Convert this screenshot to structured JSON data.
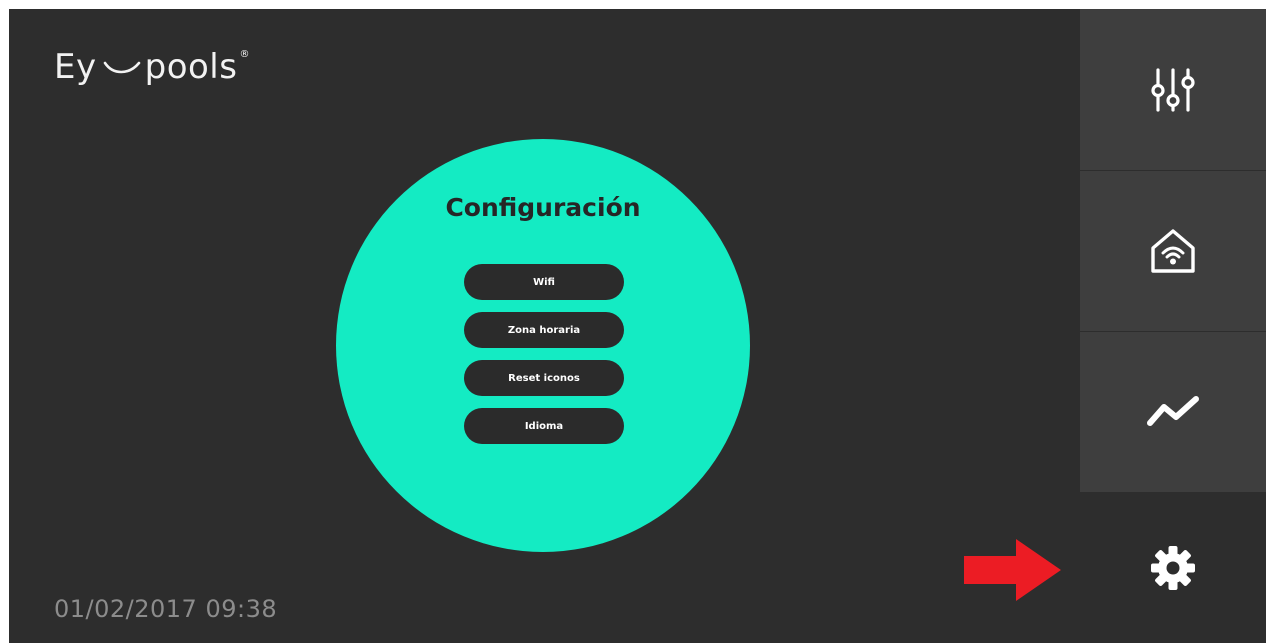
{
  "brand": {
    "name_left": "Ey",
    "name_right": "pools",
    "registered_mark": "®"
  },
  "config_panel": {
    "title": "Configuración",
    "buttons": [
      {
        "label": "Wifi"
      },
      {
        "label": "Zona horaria"
      },
      {
        "label": "Reset iconos"
      },
      {
        "label": "Idioma"
      }
    ]
  },
  "status": {
    "datetime": "01/02/2017 09:38"
  },
  "sidebar": {
    "items": [
      {
        "icon": "sliders-icon"
      },
      {
        "icon": "home-wifi-icon"
      },
      {
        "icon": "trend-line-icon"
      },
      {
        "icon": "gear-icon",
        "active": true
      }
    ]
  },
  "colors": {
    "background": "#2d2d2d",
    "sidebar_button": "#3e3e3e",
    "accent": "#14ebc3",
    "button_dark": "#2b2b2b",
    "datetime_text": "#8c8c8c",
    "annotation_arrow": "#ec1c24"
  }
}
